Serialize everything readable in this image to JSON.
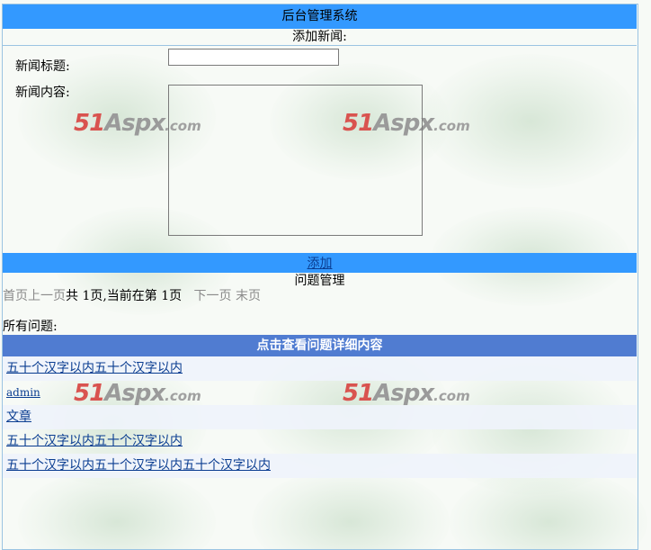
{
  "header": {
    "title": "后台管理系统"
  },
  "form": {
    "heading": "添加新闻:",
    "title_label": "新闻标题:",
    "title_value": "",
    "content_label": "新闻内容:",
    "content_value": "",
    "add_label": "添加"
  },
  "questions": {
    "heading": "问题管理",
    "pager": {
      "first": "首页",
      "prev": "上一页",
      "summary": "共 1页,当前在第 1页",
      "next": "下一页",
      "last": "末页"
    },
    "all_label": "所有问题:",
    "table_header": "点击查看问题详细内容",
    "rows": [
      {
        "text": "五十个汉字以内五十个汉字以内"
      },
      {
        "text": "admin"
      },
      {
        "text": "文章"
      },
      {
        "text": "五十个汉字以内五十个汉字以内"
      },
      {
        "text": "五十个汉字以内五十个汉字以内五十个汉字以内"
      }
    ]
  },
  "watermark": {
    "num": "51",
    "brand": "Aspx",
    "suffix": ".com"
  },
  "colors": {
    "header_bg": "#3399ff",
    "table_header_bg": "#507cd1",
    "alt_row_bg": "#eff3fb",
    "link": "#0a3d91"
  }
}
